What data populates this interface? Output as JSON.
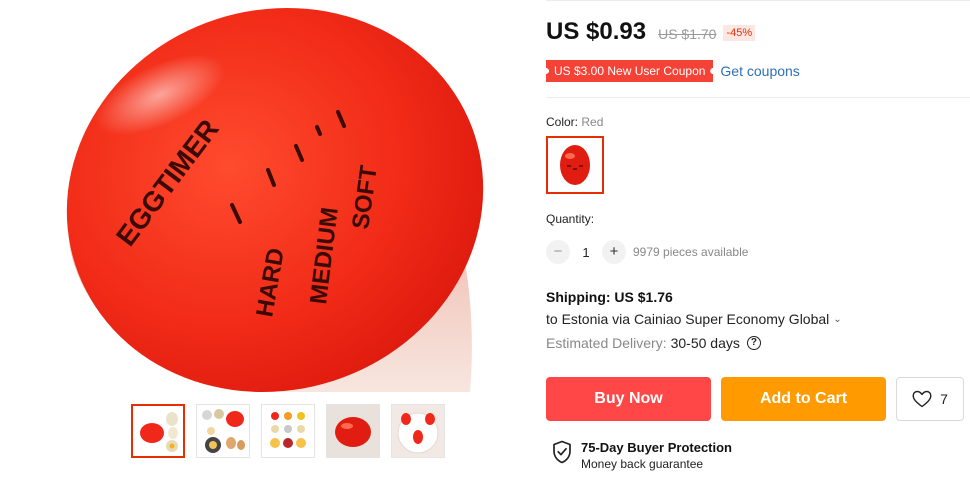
{
  "gallery": {
    "egg_texts": {
      "brand": "EGGTIMER",
      "hard": "HARD",
      "medium": "MEDIUM",
      "soft": "SOFT"
    },
    "thumbnails": [
      {
        "icon": "egg-timer-with-eggs-thumbnail",
        "active": true
      },
      {
        "icon": "egg-timer-collage-thumbnail",
        "active": false
      },
      {
        "icon": "egg-timer-steps-thumbnail",
        "active": false
      },
      {
        "icon": "egg-timer-closeup-thumbnail",
        "active": false
      },
      {
        "icon": "egg-timer-plate-thumbnail",
        "active": false
      }
    ]
  },
  "price": {
    "current": "US $0.93",
    "original": "US $1.70",
    "discount": "-45%"
  },
  "coupon": {
    "label": "US $3.00 New User Coupon",
    "link": "Get coupons"
  },
  "color": {
    "label": "Color:",
    "value": "Red",
    "swatch_icon": "red-egg-timer-swatch"
  },
  "quantity": {
    "label": "Quantity:",
    "value": "1",
    "minus": "−",
    "plus": "+",
    "available": "9979 pieces available"
  },
  "shipping": {
    "title": "Shipping: US $1.76",
    "destination": "to Estonia via Cainiao Super Economy Global",
    "chevron": "⌄",
    "delivery_label": "Estimated Delivery:",
    "delivery_days": "30-50 days",
    "help": "?"
  },
  "actions": {
    "buy_now": "Buy Now",
    "add_to_cart": "Add to Cart",
    "wishlist_count": "7"
  },
  "protection": {
    "title": "75-Day Buyer Protection",
    "subtitle": "Money back guarantee"
  },
  "colors": {
    "accent_red": "#ff4747",
    "orange": "#ff9a00",
    "link_blue": "#2e6fb7",
    "egg_red": "#f0281c"
  }
}
